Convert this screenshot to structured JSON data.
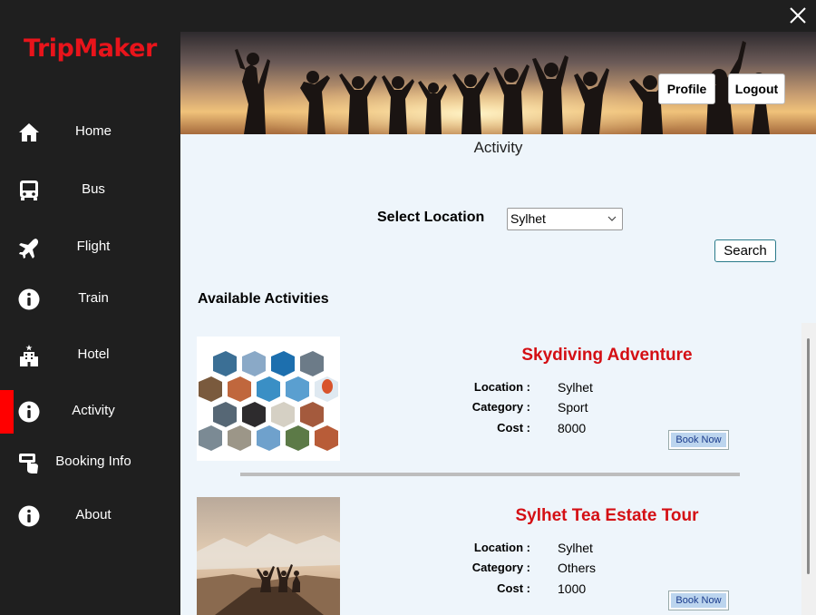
{
  "app": {
    "logo": "TripMaker"
  },
  "window": {
    "close_icon": "close-icon"
  },
  "sidebar": {
    "items": [
      {
        "label": "Home",
        "icon": "home-icon"
      },
      {
        "label": "Bus",
        "icon": "bus-icon"
      },
      {
        "label": "Flight",
        "icon": "airplane-icon"
      },
      {
        "label": "Train",
        "icon": "info-icon"
      },
      {
        "label": "Hotel",
        "icon": "hotel-icon"
      },
      {
        "label": "Activity",
        "icon": "info-icon",
        "active": true
      },
      {
        "label": "Booking Info",
        "icon": "booking-icon"
      },
      {
        "label": "About",
        "icon": "info-icon"
      }
    ]
  },
  "header": {
    "profile_label": "Profile",
    "logout_label": "Logout"
  },
  "main": {
    "title": "Activity",
    "select_label": "Select Location",
    "selected_location": "Sylhet",
    "search_label": "Search",
    "section_title": "Available Activities"
  },
  "activities": [
    {
      "title": "Skydiving Adventure",
      "location_key": "Location :",
      "location": "Sylhet",
      "category_key": "Category :",
      "category": "Sport",
      "cost_key": "Cost :",
      "cost": "8000",
      "book_label": "Book Now"
    },
    {
      "title": "Sylhet Tea Estate Tour",
      "location_key": "Location :",
      "location": "Sylhet",
      "category_key": "Category :",
      "category": "Others",
      "cost_key": "Cost :",
      "cost": "1000",
      "book_label": "Book Now"
    }
  ],
  "colors": {
    "brand": "#e8141b",
    "sidebar_bg": "#1f1f1f",
    "active_marker": "#ff0000",
    "content_bg": "#eef5fb"
  }
}
